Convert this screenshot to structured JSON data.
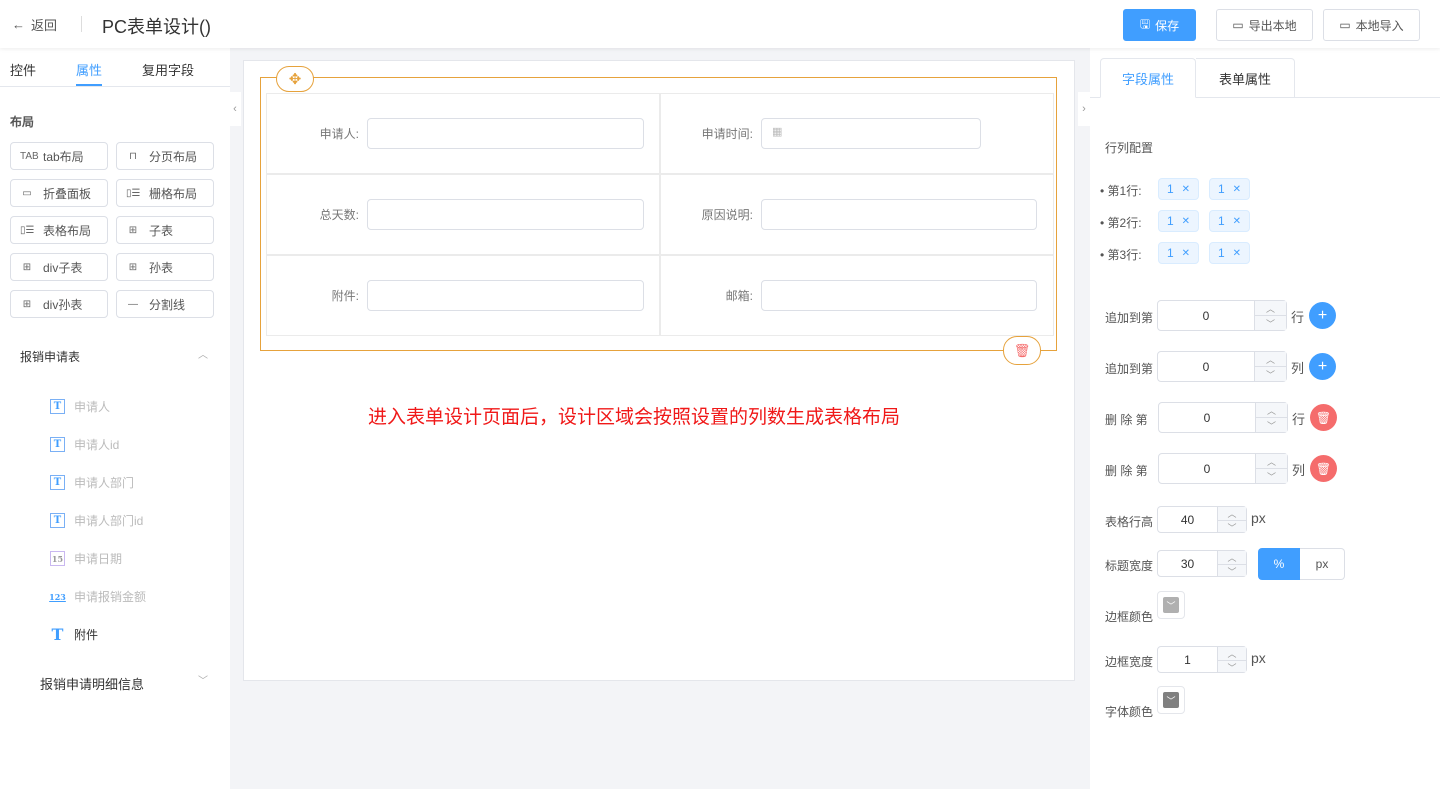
{
  "header": {
    "back_label": "返回",
    "title": "PC表单设计()",
    "save_label": "保存",
    "export_label": "导出本地",
    "import_label": "本地导入"
  },
  "left": {
    "tabs": [
      "控件",
      "属性",
      "复用字段"
    ],
    "layout_title": "布局",
    "controls": [
      {
        "label": "tab布局",
        "icon": "TAB"
      },
      {
        "label": "分页布局",
        "icon": "⊓"
      },
      {
        "label": "折叠面板",
        "icon": "▭"
      },
      {
        "label": "栅格布局",
        "icon": "▯☰"
      },
      {
        "label": "表格布局",
        "icon": "▯☰"
      },
      {
        "label": "子表",
        "icon": "⊞"
      },
      {
        "label": "div子表",
        "icon": "⊞"
      },
      {
        "label": "孙表",
        "icon": "⊞"
      },
      {
        "label": "div孙表",
        "icon": "⊞"
      },
      {
        "label": "分割线",
        "icon": "—"
      }
    ],
    "group1": "报销申请表",
    "fields": [
      {
        "label": "申请人",
        "icon": "T"
      },
      {
        "label": "申请人id",
        "icon": "T"
      },
      {
        "label": "申请人部门",
        "icon": "T"
      },
      {
        "label": "申请人部门id",
        "icon": "T"
      },
      {
        "label": "申请日期",
        "icon": "15"
      },
      {
        "label": "申请报销金额",
        "icon": "123"
      },
      {
        "label": "附件",
        "icon": "T"
      }
    ],
    "group2": "报销申请明细信息"
  },
  "canvas": {
    "cells": [
      {
        "label": "申请人:"
      },
      {
        "label": "申请时间:"
      },
      {
        "label": "总天数:"
      },
      {
        "label": "原因说明:"
      },
      {
        "label": "附件:"
      },
      {
        "label": "邮箱:"
      }
    ],
    "annotation": "进入表单设计页面后，设计区域会按照设置的列数生成表格布局"
  },
  "right": {
    "tabs": [
      "字段属性",
      "表单属性"
    ],
    "rowcol_title": "行列配置",
    "rows": [
      {
        "label": "第1行:",
        "tags": [
          "1",
          "1"
        ]
      },
      {
        "label": "第2行:",
        "tags": [
          "1",
          "1"
        ]
      },
      {
        "label": "第3行:",
        "tags": [
          "1",
          "1"
        ]
      }
    ],
    "add_row": {
      "label": "追加到第",
      "value": "0",
      "unit": "行"
    },
    "add_col": {
      "label": "追加到第",
      "value": "0",
      "unit": "列"
    },
    "del_row": {
      "label": "删 除 第",
      "value": "0",
      "unit": "行"
    },
    "del_col": {
      "label": "删 除 第",
      "value": "0",
      "unit": "列"
    },
    "row_height": {
      "label": "表格行高",
      "value": "40",
      "unit": "px"
    },
    "title_width": {
      "label": "标题宽度",
      "value": "30",
      "opt1": "%",
      "opt2": "px"
    },
    "border_color": {
      "label": "边框颜色",
      "color": "#b0b0b0"
    },
    "border_width": {
      "label": "边框宽度",
      "value": "1",
      "unit": "px"
    },
    "font_color": {
      "label": "字体颜色",
      "color": "#808080"
    }
  }
}
